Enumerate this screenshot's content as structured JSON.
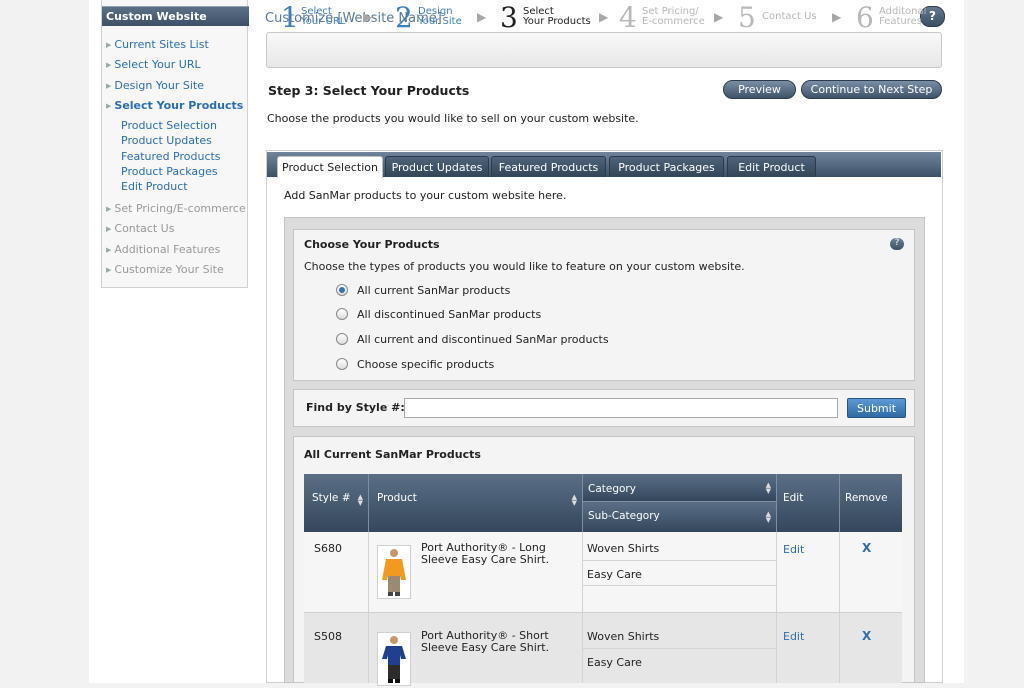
{
  "sidebar": {
    "header": "Custom Website",
    "items": [
      {
        "label": "Current Sites List",
        "state": "link"
      },
      {
        "label": "Select Your URL",
        "state": "link"
      },
      {
        "label": "Design Your Site",
        "state": "link"
      },
      {
        "label": "Select Your Products",
        "state": "active"
      },
      {
        "label": "Set Pricing/E-commerce",
        "state": "disabled"
      },
      {
        "label": "Contact Us",
        "state": "disabled"
      },
      {
        "label": "Additional Features",
        "state": "disabled"
      },
      {
        "label": "Customize Your Site",
        "state": "disabled"
      }
    ],
    "subitems": [
      "Product Selection",
      "Product Updates",
      "Featured Products",
      "Product Packages",
      "Edit Product"
    ]
  },
  "header": {
    "title": "Customize [Website Name]",
    "help": "?"
  },
  "steps": [
    {
      "num": "1",
      "line1": "Select",
      "line2": "Your URL",
      "state": "done"
    },
    {
      "num": "2",
      "line1": "Design",
      "line2": "Your Site",
      "state": "done"
    },
    {
      "num": "3",
      "line1": "Select",
      "line2": "Your Products",
      "state": "current"
    },
    {
      "num": "4",
      "line1": "Set Pricing/",
      "line2": "E-commerce",
      "state": "future"
    },
    {
      "num": "5",
      "line1": "Contact Us",
      "line2": "",
      "state": "future"
    },
    {
      "num": "6",
      "line1": "Additonal",
      "line2": "Features",
      "state": "future"
    }
  ],
  "main": {
    "heading": "Step 3: Select Your Products",
    "preview_label": "Preview",
    "continue_label": "Continue to Next Step",
    "intro": "Choose the products you would like to sell on your custom website.",
    "tabs": [
      "Product Selection",
      "Product Updates",
      "Featured Products",
      "Product Packages",
      "Edit Product"
    ],
    "tab_desc": "Add SanMar products to your custom website here.",
    "choose": {
      "title": "Choose Your Products",
      "help": "?",
      "desc": "Choose the types of products you would like to feature on your custom website.",
      "options": [
        {
          "label": "All current SanMar products",
          "selected": true
        },
        {
          "label": "All discontinued SanMar products",
          "selected": false
        },
        {
          "label": "All current and discontinued SanMar products",
          "selected": false
        },
        {
          "label": "Choose specific products",
          "selected": false
        }
      ]
    },
    "find": {
      "label": "Find by Style #:",
      "value": "",
      "submit_label": "Submit"
    },
    "list": {
      "title": "All Current SanMar Products",
      "columns": {
        "style": "Style #",
        "product": "Product",
        "category": "Category",
        "subcategory": "Sub-Category",
        "edit": "Edit",
        "remove": "Remove"
      },
      "rows": [
        {
          "style": "S680",
          "product_line1": "Port Authority® - Long",
          "product_line2": "Sleeve Easy Care Shirt.",
          "category": "Woven Shirts",
          "subcategory": "Easy Care",
          "edit": "Edit",
          "remove": "X",
          "shirt_color": "#f29a1d"
        },
        {
          "style": "S508",
          "product_line1": "Port Authority® - Short",
          "product_line2": "Sleeve Easy Care Shirt.",
          "category": "Woven Shirts",
          "subcategory": "Easy Care",
          "edit": "Edit",
          "remove": "X",
          "shirt_color": "#1f3f8f"
        }
      ]
    }
  }
}
